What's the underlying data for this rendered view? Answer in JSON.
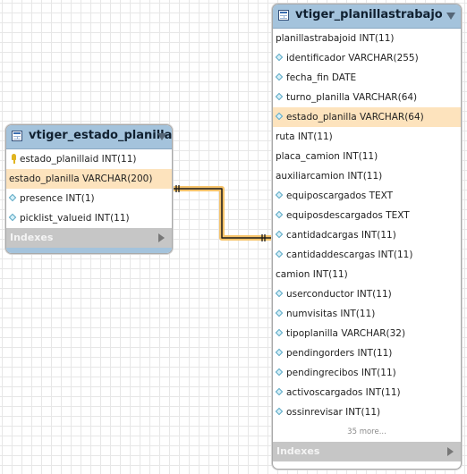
{
  "tables": {
    "estado": {
      "title": "vtiger_estado_planilla",
      "columns": [
        {
          "text": "estado_planillaid INT(11)",
          "kind": "pk"
        },
        {
          "text": "estado_planilla VARCHAR(200)",
          "kind": "plain",
          "highlight": true
        },
        {
          "text": "presence INT(1)",
          "kind": "col"
        },
        {
          "text": "picklist_valueid INT(11)",
          "kind": "col"
        }
      ],
      "indexes_label": "Indexes"
    },
    "trabajo": {
      "title": "vtiger_planillastrabajo",
      "columns": [
        {
          "text": "planillastrabajoid INT(11)",
          "kind": "plain"
        },
        {
          "text": "identificador VARCHAR(255)",
          "kind": "col"
        },
        {
          "text": "fecha_fin DATE",
          "kind": "col"
        },
        {
          "text": "turno_planilla VARCHAR(64)",
          "kind": "col"
        },
        {
          "text": "estado_planilla VARCHAR(64)",
          "kind": "col",
          "highlight": true
        },
        {
          "text": "ruta INT(11)",
          "kind": "plain"
        },
        {
          "text": "placa_camion INT(11)",
          "kind": "plain"
        },
        {
          "text": "auxiliarcamion INT(11)",
          "kind": "plain"
        },
        {
          "text": "equiposcargados TEXT",
          "kind": "col"
        },
        {
          "text": "equiposdescargados TEXT",
          "kind": "col"
        },
        {
          "text": "cantidadcargas INT(11)",
          "kind": "col"
        },
        {
          "text": "cantidaddescargas INT(11)",
          "kind": "col"
        },
        {
          "text": "camion INT(11)",
          "kind": "plain"
        },
        {
          "text": "userconductor INT(11)",
          "kind": "col"
        },
        {
          "text": "numvisitas INT(11)",
          "kind": "col"
        },
        {
          "text": "tipoplanilla VARCHAR(32)",
          "kind": "col"
        },
        {
          "text": "pendingorders INT(11)",
          "kind": "col"
        },
        {
          "text": "pendingrecibos INT(11)",
          "kind": "col"
        },
        {
          "text": "activoscargados INT(11)",
          "kind": "col"
        },
        {
          "text": "ossinrevisar INT(11)",
          "kind": "col"
        }
      ],
      "more_label": "35 more...",
      "indexes_label": "Indexes"
    }
  },
  "colors": {
    "header": "#a4c3dc",
    "highlight": "#fde3bd",
    "relationship": "#f0a020"
  }
}
